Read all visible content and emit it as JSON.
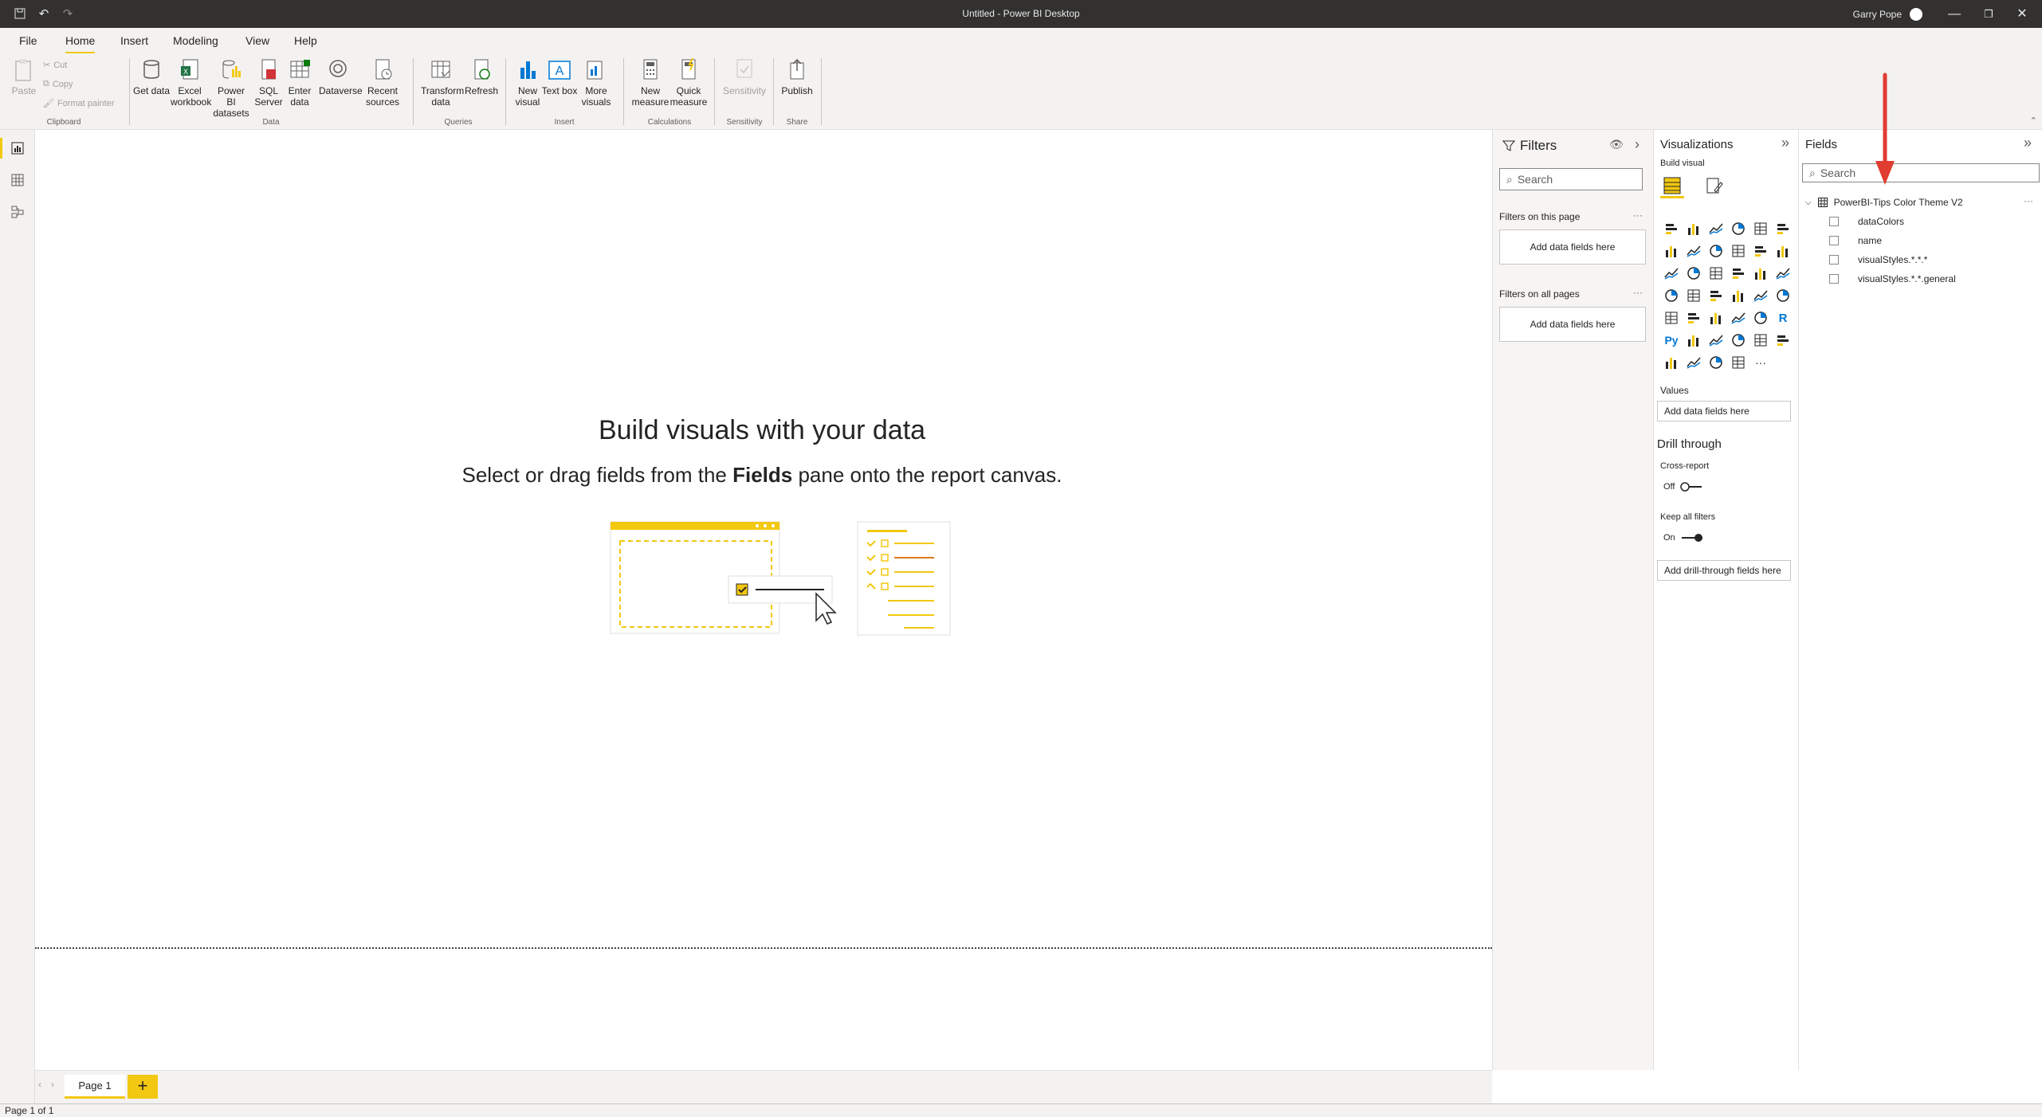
{
  "titlebar": {
    "title": "Untitled - Power BI Desktop",
    "user": "Garry Pope"
  },
  "menu": {
    "items": [
      "File",
      "Home",
      "Insert",
      "Modeling",
      "View",
      "Help"
    ],
    "active": "Home"
  },
  "ribbon": {
    "clipboard": {
      "paste": "Paste",
      "cut": "Cut",
      "copy": "Copy",
      "format_painter": "Format painter",
      "group": "Clipboard"
    },
    "data": {
      "get_data": "Get data",
      "excel": "Excel workbook",
      "pbi_datasets": "Power BI datasets",
      "sql": "SQL Server",
      "enter_data": "Enter data",
      "dataverse": "Dataverse",
      "recent": "Recent sources",
      "group": "Data"
    },
    "queries": {
      "transform": "Transform data",
      "refresh": "Refresh",
      "group": "Queries"
    },
    "insert": {
      "new_visual": "New visual",
      "text_box": "Text box",
      "more_visuals": "More visuals",
      "group": "Insert"
    },
    "calculations": {
      "new_measure": "New measure",
      "quick_measure": "Quick measure",
      "group": "Calculations"
    },
    "sensitivity": {
      "label": "Sensitivity",
      "group": "Sensitivity"
    },
    "share": {
      "publish": "Publish",
      "group": "Share"
    }
  },
  "canvas": {
    "hint_title": "Build visuals with your data",
    "hint_sub_before": "Select or drag fields from the ",
    "hint_sub_bold": "Fields",
    "hint_sub_after": " pane onto the report canvas."
  },
  "pages": {
    "tab": "Page 1",
    "add": "+",
    "status": "Page 1 of 1"
  },
  "filters": {
    "title": "Filters",
    "search_placeholder": "Search",
    "on_page": "Filters on this page",
    "on_all": "Filters on all pages",
    "drop": "Add data fields here",
    "more": "···"
  },
  "visualizations": {
    "title": "Visualizations",
    "build_visual": "Build visual",
    "values": "Values",
    "values_drop": "Add data fields here",
    "drill_through": "Drill through",
    "cross_report": "Cross-report",
    "cross_report_state": "Off",
    "keep_filters": "Keep all filters",
    "keep_filters_state": "On",
    "drill_drop": "Add drill-through fields here",
    "accent_color": "#f2c811"
  },
  "fields": {
    "title": "Fields",
    "search_placeholder": "Search",
    "table_name": "PowerBI-Tips Color Theme V2",
    "items": [
      "dataColors",
      "name",
      "visualStyles.*.*.*",
      "visualStyles.*.*.general"
    ]
  },
  "annotation": {
    "color": "#e03c31"
  }
}
